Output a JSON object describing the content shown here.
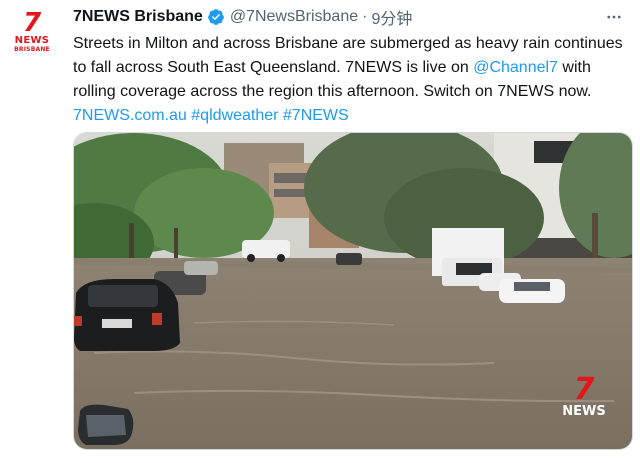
{
  "account": {
    "avatar_logo_number": "7",
    "avatar_logo_word": "NEWS",
    "avatar_logo_sub": "BRISBANE",
    "display_name": "7NEWS Brisbane",
    "handle": "@7NewsBrisbane",
    "separator": "·",
    "time": "9分钟",
    "verified_icon": "verified-badge-icon",
    "more_icon": "more-horizontal-icon"
  },
  "tweet": {
    "text_1": "Streets in Milton and across Brisbane are submerged as heavy rain continues to fall across South East Queensland. 7NEWS is live on ",
    "mention": "@Channel7",
    "text_2": " with rolling coverage across the region this afternoon. Switch on 7NEWS now. ",
    "link": "7NEWS.com.au",
    "space": " ",
    "hashtag_1": "#qldweather",
    "hashtag_2": "#7NEWS",
    "link_color": "#1d9bf0"
  },
  "media": {
    "watermark_number": "7",
    "watermark_word": "NEWS",
    "description_icon": "flooded-street-photo"
  },
  "colors": {
    "brand_red": "#e3161b",
    "text_primary": "#0f1419",
    "text_secondary": "#536471"
  }
}
